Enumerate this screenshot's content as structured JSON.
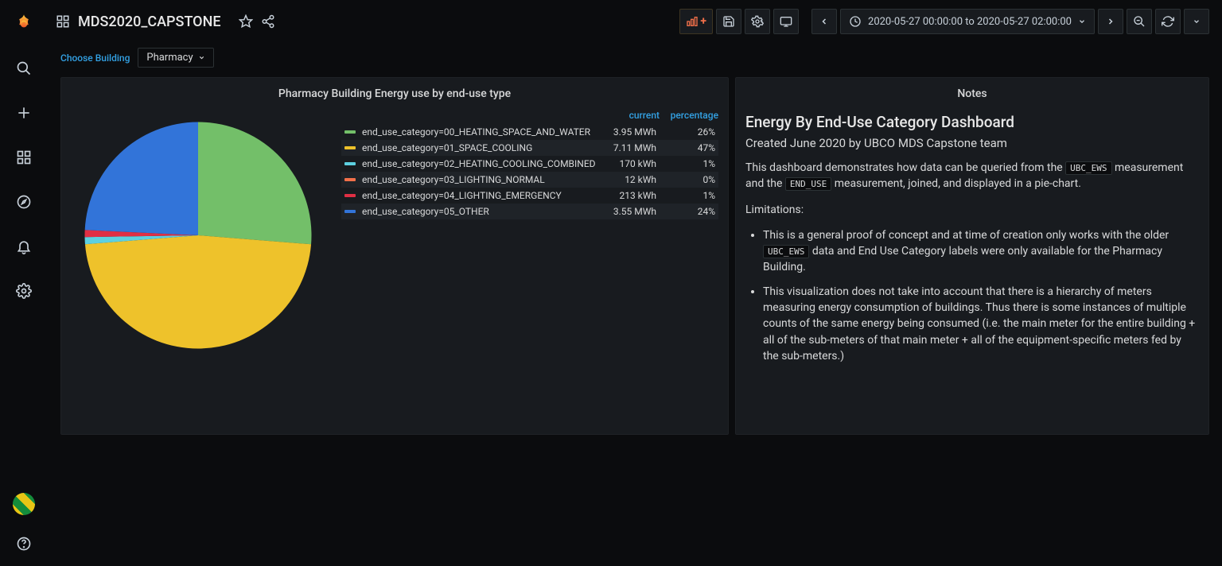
{
  "header": {
    "dashboard_title": "MDS2020_CAPSTONE",
    "time_range": "2020-05-27 00:00:00 to 2020-05-27 02:00:00"
  },
  "variables": {
    "label": "Choose Building",
    "selected": "Pharmacy"
  },
  "pie_panel": {
    "title": "Pharmacy Building Energy use by end-use type",
    "columns": {
      "c1": "current",
      "c2": "percentage"
    },
    "rows": [
      {
        "color": "#73bf69",
        "name": "end_use_category=00_HEATING_SPACE_AND_WATER",
        "current": "3.95 MWh",
        "percentage": "26%"
      },
      {
        "color": "#eec22b",
        "name": "end_use_category=01_SPACE_COOLING",
        "current": "7.11 MWh",
        "percentage": "47%"
      },
      {
        "color": "#5dd0e0",
        "name": "end_use_category=02_HEATING_COOLING_COMBINED",
        "current": "170 kWh",
        "percentage": "1%"
      },
      {
        "color": "#f2704a",
        "name": "end_use_category=03_LIGHTING_NORMAL",
        "current": "12 kWh",
        "percentage": "0%"
      },
      {
        "color": "#e02f44",
        "name": "end_use_category=04_LIGHTING_EMERGENCY",
        "current": "213 kWh",
        "percentage": "1%"
      },
      {
        "color": "#3274d9",
        "name": "end_use_category=05_OTHER",
        "current": "3.55 MWh",
        "percentage": "24%"
      }
    ]
  },
  "notes_panel": {
    "title": "Notes",
    "heading": "Energy By End-Use Category Dashboard",
    "subheading": "Created June 2020 by UBCO MDS Capstone team",
    "intro_pre": "This dashboard demonstrates how data can be queried from the ",
    "code1": "UBC_EWS",
    "intro_mid": " measurement and the ",
    "code2": "END_USE",
    "intro_post": " measurement, joined, and displayed in a pie-chart.",
    "limitations_label": "Limitations:",
    "lim1_pre": "This is a general proof of concept and at time of creation only works with the older ",
    "lim1_code": "UBC_EWS",
    "lim1_post": " data and End Use Category labels were only available for the Pharmacy Building.",
    "lim2": "This visualization does not take into account that there is a hierarchy of meters measuring energy consumption of buildings. Thus there is some instances of multiple counts of the same energy being consumed (i.e. the main meter for the entire building + all of the sub-meters of that main meter + all of the equipment-specific meters fed by the sub-meters.)"
  },
  "chart_data": {
    "type": "pie",
    "title": "Pharmacy Building Energy use by end-use type",
    "categories": [
      "00_HEATING_SPACE_AND_WATER",
      "01_SPACE_COOLING",
      "02_HEATING_COOLING_COMBINED",
      "03_LIGHTING_NORMAL",
      "04_LIGHTING_EMERGENCY",
      "05_OTHER"
    ],
    "values": [
      26,
      47,
      1,
      0,
      1,
      24
    ],
    "value_label": "percentage",
    "raw_values": [
      "3.95 MWh",
      "7.11 MWh",
      "170 kWh",
      "12 kWh",
      "213 kWh",
      "3.55 MWh"
    ],
    "colors": [
      "#73bf69",
      "#eec22b",
      "#5dd0e0",
      "#f2704a",
      "#e02f44",
      "#3274d9"
    ]
  }
}
